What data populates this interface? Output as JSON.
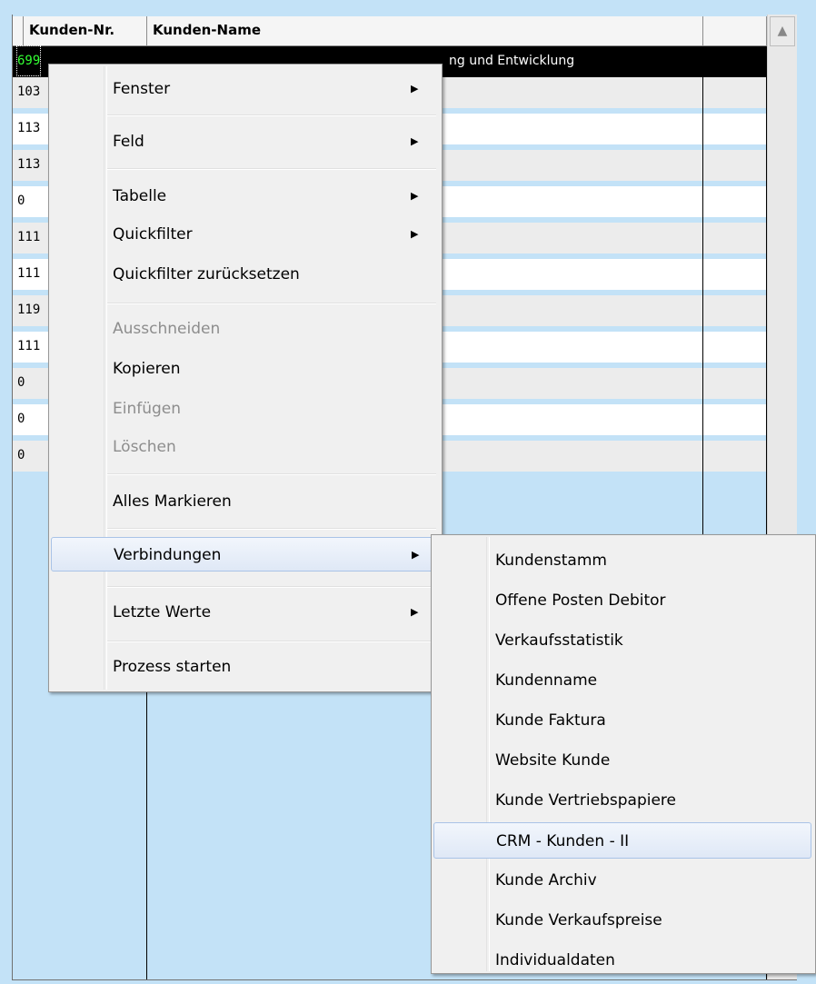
{
  "grid": {
    "headers": [
      "Kunden-Nr.",
      "Kunden-Name",
      ""
    ],
    "rows": [
      {
        "nr": "699",
        "name": "ng und Entwicklung"
      },
      {
        "nr": "103",
        "name": ""
      },
      {
        "nr": "113",
        "name": ""
      },
      {
        "nr": "113",
        "name": ""
      },
      {
        "nr": "0",
        "name": ""
      },
      {
        "nr": "111",
        "name": ""
      },
      {
        "nr": "111",
        "name": ""
      },
      {
        "nr": "119",
        "name": ""
      },
      {
        "nr": "111",
        "name": ""
      },
      {
        "nr": "0",
        "name": ""
      },
      {
        "nr": "0",
        "name": ""
      },
      {
        "nr": "0",
        "name": ""
      }
    ],
    "scroll_up_glyph": "▲"
  },
  "context_menu": {
    "items": [
      {
        "label": "Fenster",
        "submenu": true,
        "disabled": false
      },
      {
        "label": "Feld",
        "submenu": true,
        "disabled": false
      },
      {
        "label": "Tabelle",
        "submenu": true,
        "disabled": false
      },
      {
        "label": "Quickfilter",
        "submenu": true,
        "disabled": false
      },
      {
        "label": "Quickfilter zurücksetzen",
        "submenu": false,
        "disabled": false
      },
      {
        "label": "Ausschneiden",
        "submenu": false,
        "disabled": true
      },
      {
        "label": "Kopieren",
        "submenu": false,
        "disabled": false
      },
      {
        "label": "Einfügen",
        "submenu": false,
        "disabled": true
      },
      {
        "label": "Löschen",
        "submenu": false,
        "disabled": true
      },
      {
        "label": "Alles Markieren",
        "submenu": false,
        "disabled": false
      },
      {
        "label": "Verbindungen",
        "submenu": true,
        "disabled": false,
        "highlighted": true
      },
      {
        "label": "Letzte Werte",
        "submenu": true,
        "disabled": false
      },
      {
        "label": "Prozess starten",
        "submenu": false,
        "disabled": false
      }
    ],
    "arrow_glyph": "▶"
  },
  "submenu_verbindungen": {
    "items": [
      {
        "label": "Kundenstamm"
      },
      {
        "label": "Offene Posten Debitor"
      },
      {
        "label": "Verkaufsstatistik"
      },
      {
        "label": "Kundenname"
      },
      {
        "label": "Kunde Faktura"
      },
      {
        "label": "Website Kunde"
      },
      {
        "label": "Kunde Vertriebspapiere"
      },
      {
        "label": "CRM - Kunden - II",
        "highlighted": true
      },
      {
        "label": "Kunde Archiv"
      },
      {
        "label": "Kunde Verkaufspreise"
      },
      {
        "label": "Individualdaten"
      }
    ]
  }
}
